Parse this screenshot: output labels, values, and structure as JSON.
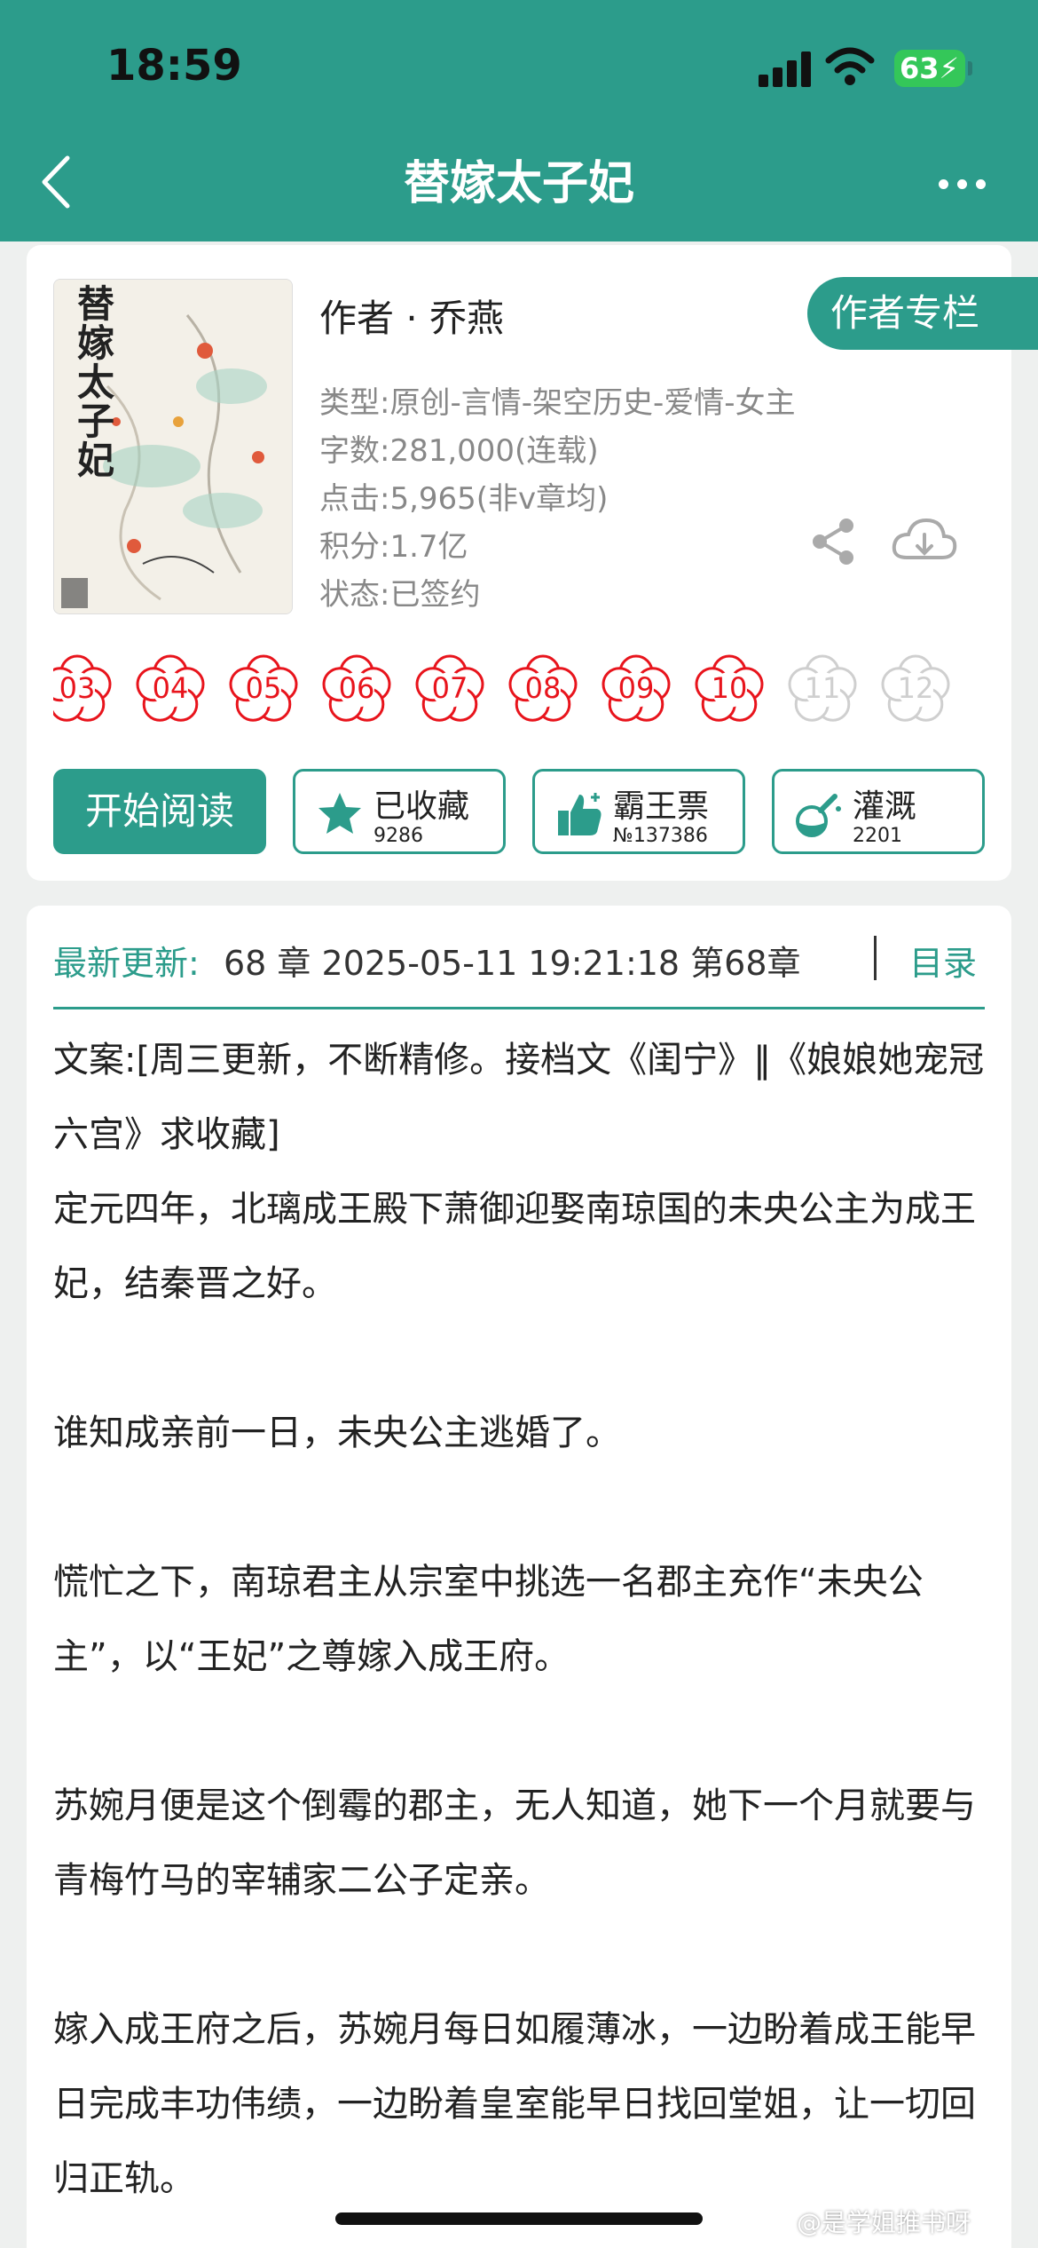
{
  "status_bar": {
    "time": "18:59",
    "battery": "63"
  },
  "nav": {
    "title": "替嫁太子妃"
  },
  "book": {
    "cover_title": "替嫁太子妃",
    "author": "作者 · 乔燕",
    "author_column_button": "作者专栏",
    "type": "类型:原创-言情-架空历史-爱情-女主",
    "word_count": "字数:281,000(连载)",
    "clicks": "点击:5,965(非v章均)",
    "points": "积分:1.7亿",
    "state": "状态:已签约"
  },
  "ratings": {
    "flowers": [
      {
        "label": "03",
        "active": true
      },
      {
        "label": "04",
        "active": true
      },
      {
        "label": "05",
        "active": true
      },
      {
        "label": "06",
        "active": true
      },
      {
        "label": "07",
        "active": true
      },
      {
        "label": "08",
        "active": true
      },
      {
        "label": "09",
        "active": true
      },
      {
        "label": "10",
        "active": true
      },
      {
        "label": "11",
        "active": false
      },
      {
        "label": "12",
        "active": false
      }
    ],
    "active_color": "#e8141c",
    "inactive_color": "#cfcfcf"
  },
  "actions": {
    "read": "开始阅读",
    "favorite": {
      "label": "已收藏",
      "count": "9286"
    },
    "ticket": {
      "label": "霸王票",
      "count": "№137386"
    },
    "water": {
      "label": "灌溉",
      "count": "2201"
    }
  },
  "update": {
    "label": "最新更新:",
    "value": "68 章 2025-05-11 19:21:18   第68章",
    "toc": "目录"
  },
  "synopsis": [
    "文案:[周三更新，不断精修。接档文《闺宁》‖《娘娘她宠冠六宫》求收藏]",
    "定元四年，北璃成王殿下萧御迎娶南琼国的未央公主为成王妃，结秦晋之好。",
    "谁知成亲前一日，未央公主逃婚了。",
    "慌忙之下，南琼君主从宗室中挑选一名郡主充作“未央公主”，以“王妃”之尊嫁入成王府。",
    "苏婉月便是这个倒霉的郡主，无人知道，她下一个月就要与青梅竹马的宰辅家二公子定亲。",
    "嫁入成王府之后，苏婉月每日如履薄冰，一边盼着成王能早日完成丰功伟绩，一边盼着皇室能早日找回堂姐，让一切回归正轨。"
  ],
  "watermark": "@是学姐推书呀",
  "colors": {
    "accent": "#2c9c8b"
  }
}
